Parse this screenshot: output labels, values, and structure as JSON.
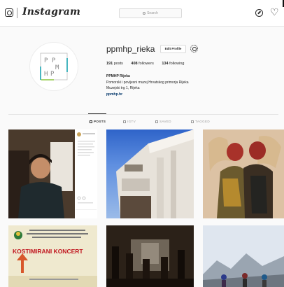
{
  "nav": {
    "wordmark": "Instagram",
    "search_placeholder": "Search",
    "icons": [
      "camera-icon",
      "compass-icon",
      "heart-icon"
    ]
  },
  "profile": {
    "username": "ppmhp_rieka",
    "edit_label": "Edit Profile",
    "stats": [
      {
        "value": "191",
        "label": "posts"
      },
      {
        "value": "408",
        "label": "followers"
      },
      {
        "value": "134",
        "label": "following"
      }
    ],
    "name": "PPMHP Rijeka",
    "bio_line1": "Pomorski i povijesni muzej Hrvatskog primorja Rijeka",
    "bio_line2": "Muzejski trg 1, Rijeka",
    "website": "ppmhp.hr",
    "logo_letters": [
      "P",
      "P",
      "M",
      "H",
      "P"
    ]
  },
  "tabs": [
    {
      "label": "POSTS",
      "active": true
    },
    {
      "label": "IGTV",
      "active": false
    },
    {
      "label": "SAVED",
      "active": false
    },
    {
      "label": "TAGGED",
      "active": false
    }
  ],
  "posts": {
    "p4_text": "KOSTIMIRANI KONCERT"
  },
  "colors": {
    "link": "#003569",
    "border": "#dbdbdb",
    "background": "#fafafa",
    "logo_teal": "#1aa3b0",
    "logo_green": "#8cc63f"
  }
}
